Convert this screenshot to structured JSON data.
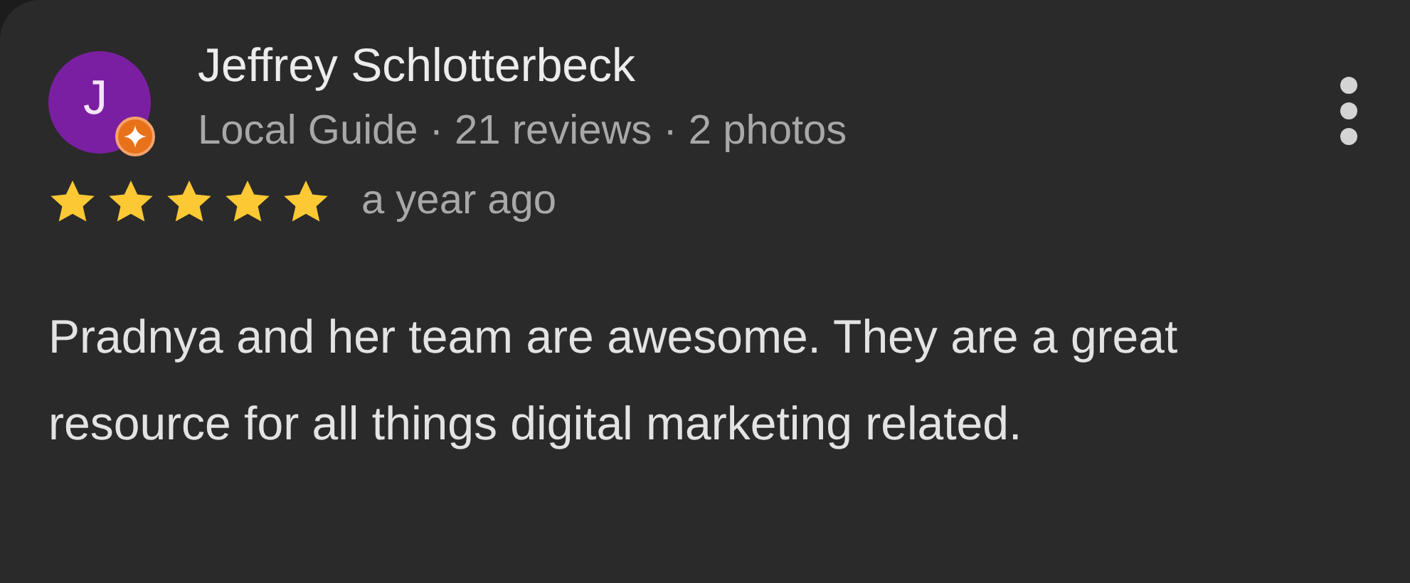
{
  "review": {
    "avatar_initial": "J",
    "local_guide": true,
    "name": "Jeffrey Schlotterbeck",
    "meta": "Local Guide · 21 reviews · 2 photos",
    "stars": 5,
    "time": "a year ago",
    "text": "Pradnya and her team are awesome. They are a great resource for all things digital marketing related."
  }
}
